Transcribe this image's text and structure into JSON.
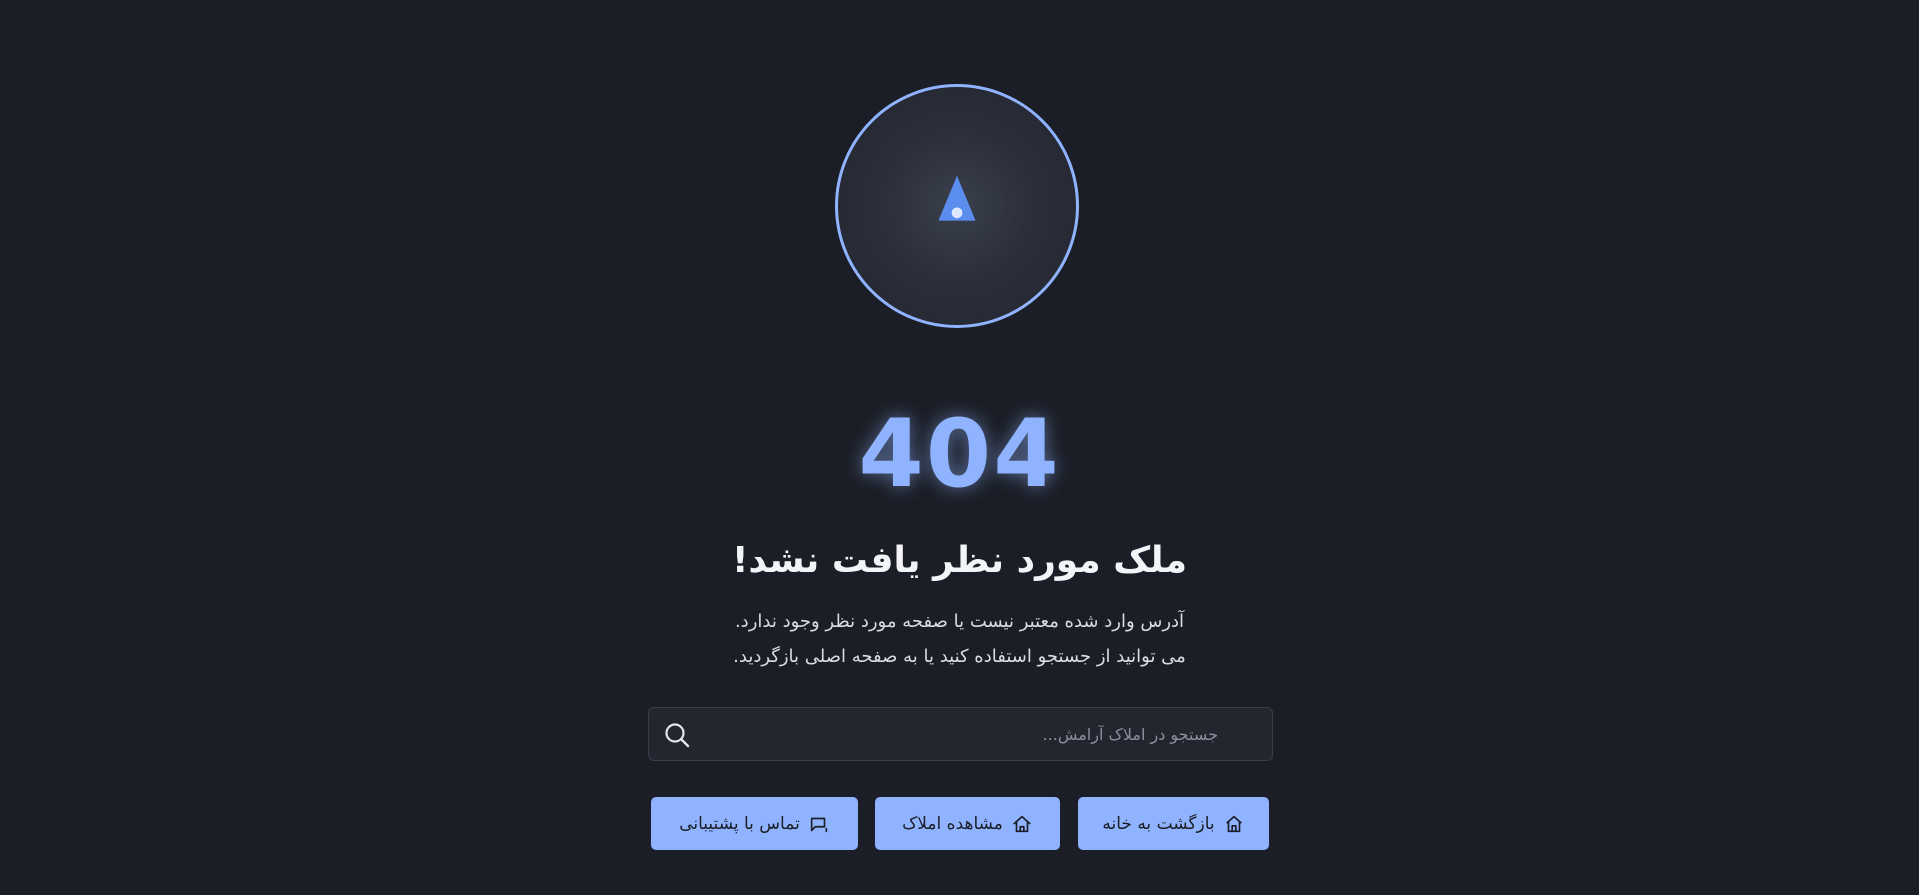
{
  "error": {
    "code": "404",
    "title": "ملک مورد نظر یافت نشد!",
    "description_line1": "آدرس وارد شده معتبر نیست یا صفحه مورد نظر وجود ندارد.",
    "description_line2": "می توانید از جستجو استفاده کنید یا به صفحه اصلی بازگردید."
  },
  "search": {
    "placeholder": "جستجو در املاک آرامش...",
    "value": "",
    "icon": "search-icon"
  },
  "actions": {
    "home": {
      "label": "بازگشت به خانه",
      "icon": "home-icon"
    },
    "properties": {
      "label": "مشاهده املاک",
      "icon": "house-icon"
    },
    "support": {
      "label": "تماس با پشتیبانی",
      "icon": "chat-icon"
    }
  },
  "colors": {
    "background": "#1b1e26",
    "accent": "#8fb3ff",
    "compass_needle": "#5b8def"
  }
}
